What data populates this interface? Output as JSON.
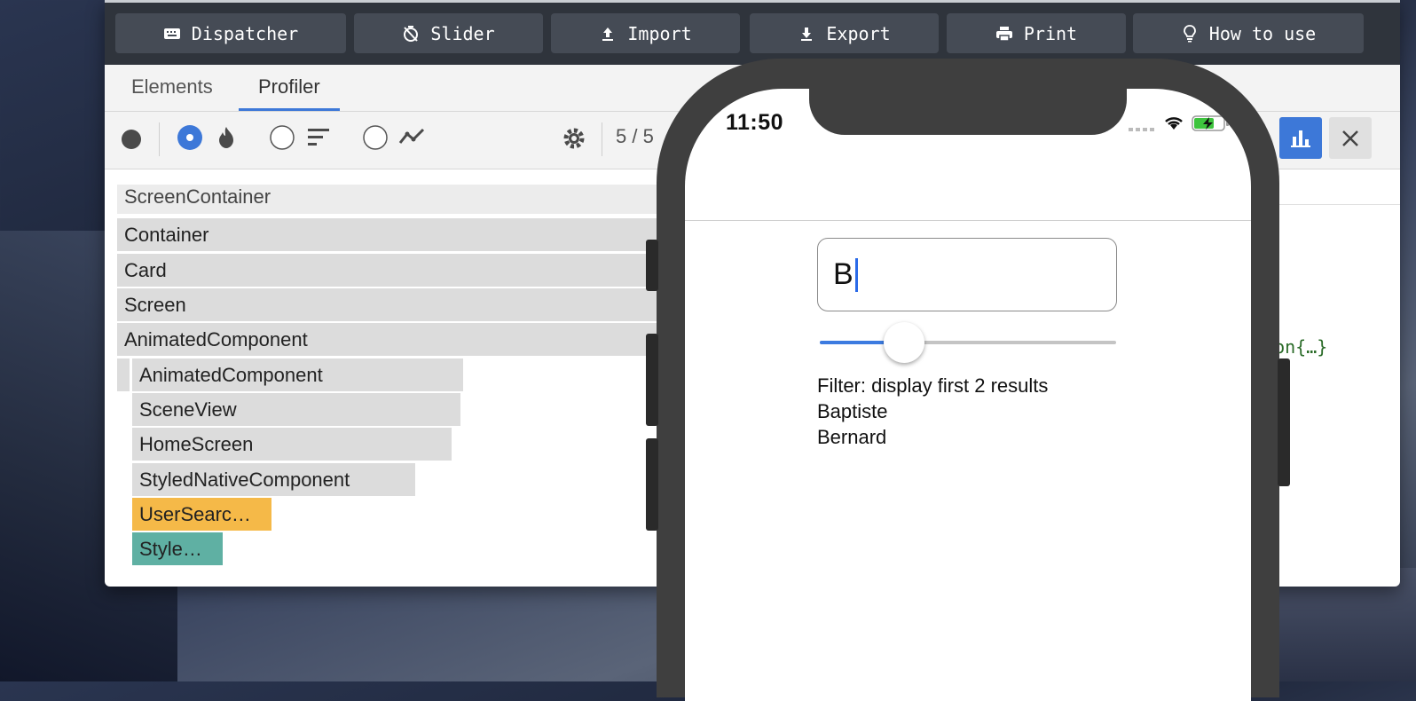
{
  "toolbar": {
    "buttons": [
      {
        "label": "Dispatcher",
        "icon": "keyboard-icon"
      },
      {
        "label": "Slider",
        "icon": "timer-off-icon"
      },
      {
        "label": "Import",
        "icon": "upload-icon"
      },
      {
        "label": "Export",
        "icon": "download-icon"
      },
      {
        "label": "Print",
        "icon": "printer-icon"
      },
      {
        "label": "How to use",
        "icon": "lightbulb-icon"
      }
    ]
  },
  "devtools": {
    "tabs": [
      {
        "label": "Elements",
        "active": false
      },
      {
        "label": "Profiler",
        "active": true
      }
    ],
    "commit_counter": "5 / 5",
    "flamegraph": [
      {
        "label": "ScreenContainer",
        "color": "lightgray"
      },
      {
        "label": "Container",
        "color": "gray"
      },
      {
        "label": "Card",
        "color": "gray"
      },
      {
        "label": "Screen",
        "color": "gray"
      },
      {
        "label": "AnimatedComponent",
        "color": "gray"
      },
      {
        "label": "AnimatedComponent",
        "color": "gray"
      },
      {
        "label": "SceneView",
        "color": "gray"
      },
      {
        "label": "HomeScreen",
        "color": "gray"
      },
      {
        "label": "StyledNativeComponent",
        "color": "gray"
      },
      {
        "label": "UserSearc…",
        "color": "#f5b948"
      },
      {
        "label": "Style…",
        "color": "#5fb0a3"
      }
    ],
    "code_snippet": "tion{…}"
  },
  "phone": {
    "time": "11:50",
    "search_value": "B",
    "slider_fraction": 0.22,
    "filter_label": "Filter: display first 2 results",
    "results": [
      "Baptiste",
      "Bernard"
    ]
  },
  "colors": {
    "accent": "#3d78d8",
    "toolbar_bg": "#2f343c",
    "highlight_yellow": "#f5b948",
    "highlight_teal": "#5fb0a3"
  }
}
